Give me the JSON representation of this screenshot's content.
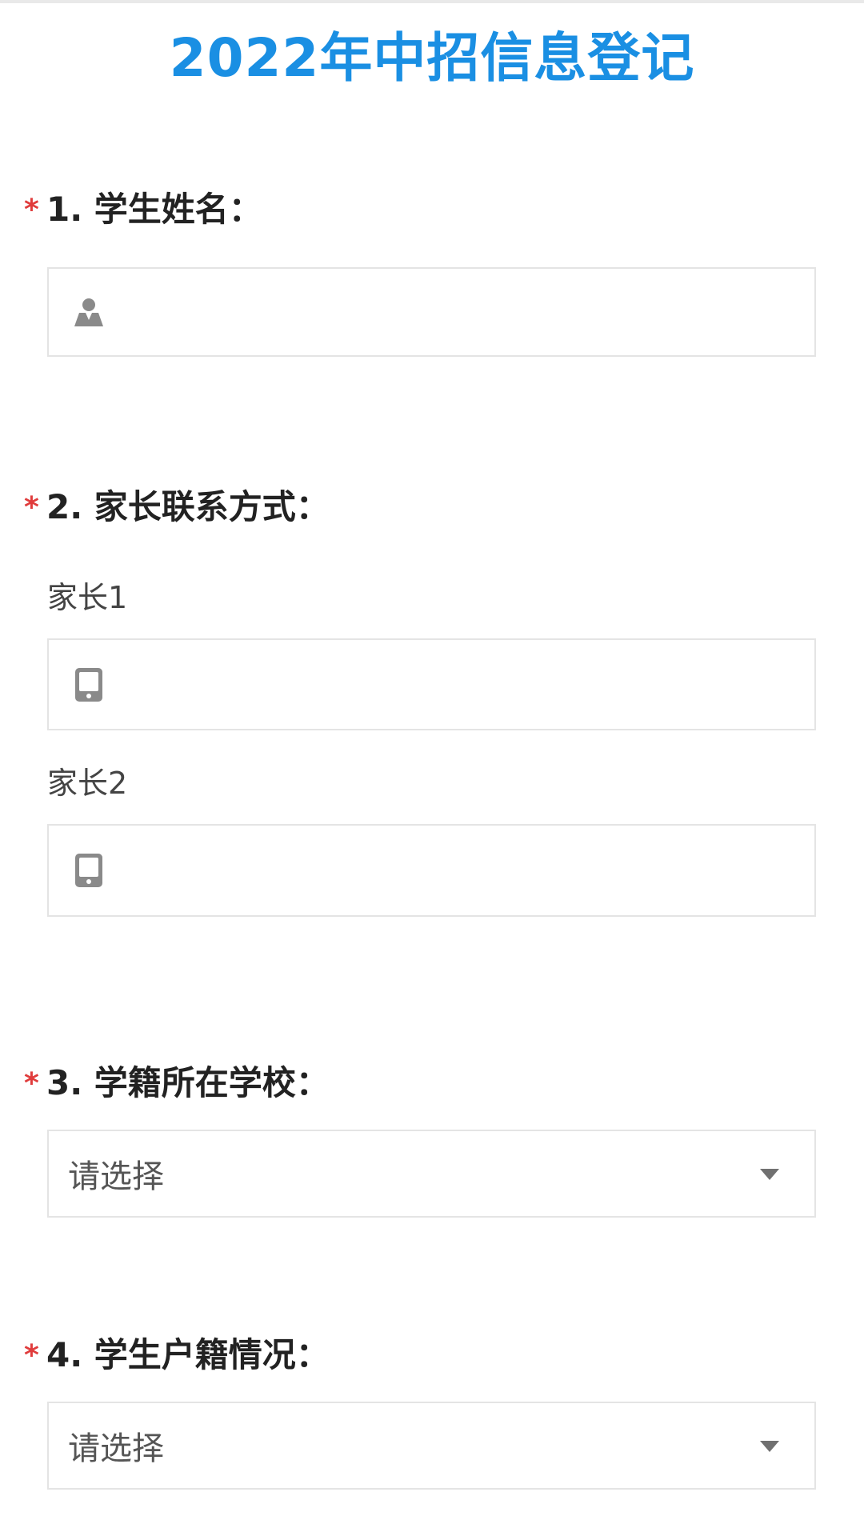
{
  "title": "2022年中招信息登记",
  "questions": [
    {
      "required_mark": "*",
      "label": "1. 学生姓名："
    },
    {
      "required_mark": "*",
      "label": "2. 家长联系方式："
    },
    {
      "required_mark": "*",
      "label": "3. 学籍所在学校："
    },
    {
      "required_mark": "*",
      "label": "4. 学生户籍情况："
    }
  ],
  "name_field": {
    "value": "",
    "icon": "person-icon"
  },
  "parents": [
    {
      "label": "家长1",
      "value": "",
      "icon": "phone-icon"
    },
    {
      "label": "家长2",
      "value": "",
      "icon": "phone-icon"
    }
  ],
  "school_select": {
    "selected": "请选择"
  },
  "hukou_select": {
    "selected": "请选择"
  },
  "colors": {
    "title": "#1a8fe3",
    "required": "#e03c3c",
    "border": "#e4e4e4",
    "icon": "#8a8a8a"
  }
}
